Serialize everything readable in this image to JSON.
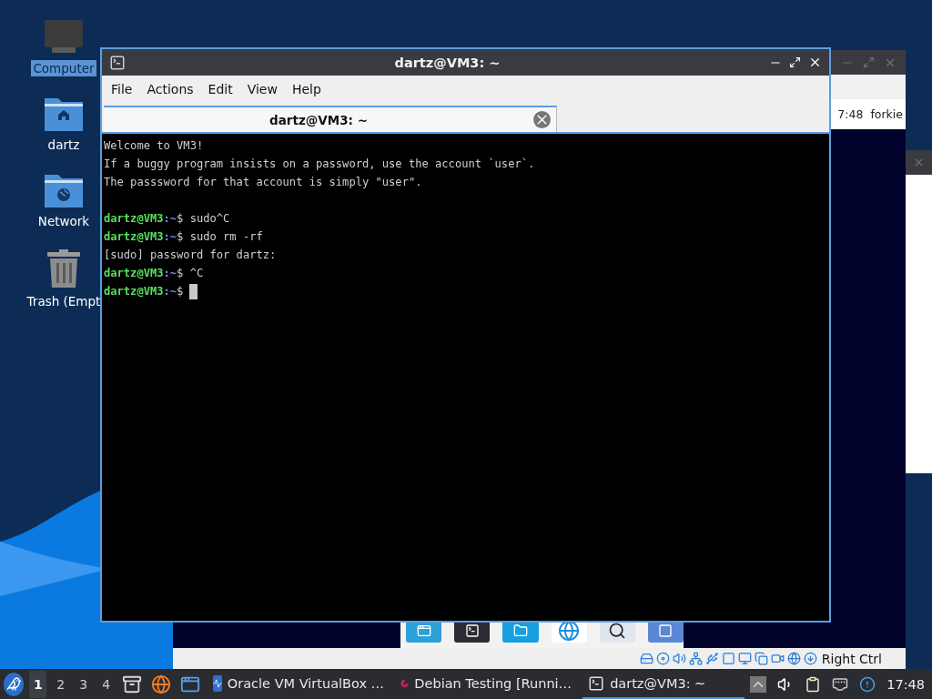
{
  "desktop_icons": [
    {
      "kind": "computer",
      "label": "Computer",
      "selected": true
    },
    {
      "kind": "home",
      "label": "dartz",
      "selected": false
    },
    {
      "kind": "network",
      "label": "Network",
      "selected": false
    },
    {
      "kind": "trash",
      "label": "Trash (Empt",
      "selected": false
    }
  ],
  "background_window": {
    "panel_texts": [
      "7:48",
      "forkie"
    ],
    "host_key": "Right Ctrl"
  },
  "terminal": {
    "title": "dartz@VM3: ~",
    "menu": [
      "File",
      "Actions",
      "Edit",
      "View",
      "Help"
    ],
    "tabs": [
      {
        "label": "dartz@VM3: ~",
        "selected": true
      }
    ],
    "lines": [
      {
        "kind": "output",
        "text": "Welcome to VM3!"
      },
      {
        "kind": "output",
        "text": "If a buggy program insists on a password, use the account `user`."
      },
      {
        "kind": "output",
        "text": "The passsword for that account is simply \"user\"."
      },
      {
        "kind": "blank"
      },
      {
        "kind": "prompt",
        "user": "dartz@VM3",
        "path": ":~",
        "input": "$ sudo^C",
        "cursor": false
      },
      {
        "kind": "prompt",
        "user": "dartz@VM3",
        "path": ":~",
        "input": "$ sudo rm -rf",
        "cursor": false
      },
      {
        "kind": "output",
        "text": "[sudo] password for dartz:"
      },
      {
        "kind": "prompt",
        "user": "dartz@VM3",
        "path": ":~",
        "input": "$ ^C",
        "cursor": false
      },
      {
        "kind": "prompt",
        "user": "dartz@VM3",
        "path": ":~",
        "input": "$",
        "cursor": true
      }
    ]
  },
  "taskbar": {
    "workspaces": [
      {
        "label": "1",
        "selected": true
      },
      {
        "label": "2",
        "selected": false
      },
      {
        "label": "3",
        "selected": false
      },
      {
        "label": "4",
        "selected": false
      }
    ],
    "tasks": [
      {
        "kind": "virtualbox",
        "label": "Oracle VM VirtualBox …",
        "selected": false
      },
      {
        "kind": "debian",
        "label": "Debian Testing [Runni…",
        "selected": false
      },
      {
        "kind": "terminal",
        "label": "dartz@VM3: ~",
        "selected": true
      }
    ],
    "clock": "17:48"
  }
}
